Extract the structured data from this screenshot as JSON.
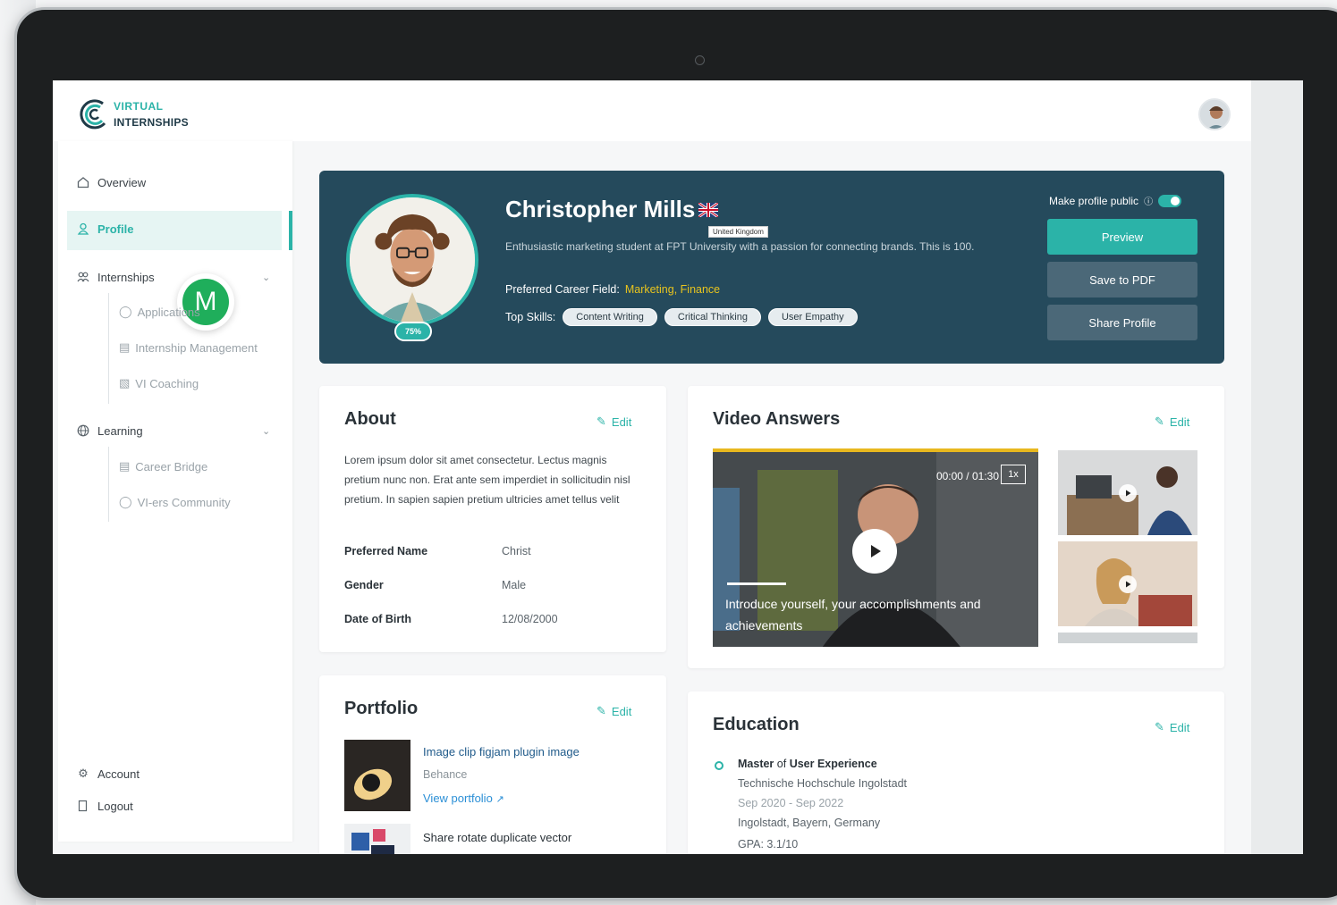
{
  "logo": {
    "line1": "VIRTUAL",
    "line2": "INTERNSHIPS"
  },
  "sidebar": {
    "overview": "Overview",
    "profile": "Profile",
    "internships": "Internships",
    "internships_sub": [
      "Applications",
      "Internship Management",
      "VI Coaching"
    ],
    "learning": "Learning",
    "learning_sub": [
      "Career Bridge",
      "VI-ers Community"
    ],
    "account": "Account",
    "logout": "Logout"
  },
  "bubble_letter": "M",
  "hero": {
    "name": "Christopher Mills",
    "flag_tooltip": "United Kingdom",
    "bio": "Enthusiastic marketing student at FPT University with a passion for connecting brands. This is 100.",
    "career_label": "Preferred Career Field:",
    "career_value": "Marketing, Finance",
    "skills_label": "Top Skills:",
    "skills": [
      "Content Writing",
      "Critical Thinking",
      "User Empathy"
    ],
    "completion": "75%",
    "make_public": "Make profile public",
    "profile_public": true,
    "preview": "Preview",
    "save_pdf": "Save to PDF",
    "share": "Share Profile"
  },
  "about": {
    "title": "About",
    "edit": "Edit",
    "text": "Lorem ipsum dolor sit amet consectetur. Lectus magnis pretium nunc non. Erat ante sem imperdiet in sollicitudin nisl pretium. In sapien sapien pretium ultricies amet tellus velit",
    "fields": [
      {
        "label": "Preferred Name",
        "value": "Christ"
      },
      {
        "label": "Gender",
        "value": "Male"
      },
      {
        "label": "Date of Birth",
        "value": "12/08/2000"
      }
    ]
  },
  "video": {
    "title": "Video Answers",
    "edit": "Edit",
    "time": "00:00 / 01:30",
    "speed": "1x",
    "caption": "Introduce yourself, your accomplishments and achievements"
  },
  "portfolio": {
    "title": "Portfolio",
    "edit": "Edit",
    "items": [
      {
        "title": "Image clip figjam plugin image",
        "source": "Behance",
        "view": "View portfolio"
      },
      {
        "title": "Share rotate duplicate vector"
      }
    ]
  },
  "education": {
    "title": "Education",
    "edit": "Edit",
    "degree_prefix": "Master",
    "degree_of": "of",
    "degree_rest": "User Experience",
    "school": "Technische Hochschule Ingolstadt",
    "dates": "Sep 2020 - Sep 2022",
    "location": "Ingolstadt, Bayern, Germany",
    "gpa": "GPA: 3.1/10"
  },
  "colors": {
    "accent": "#2bb3a8",
    "hero_bg": "#254a5c",
    "highlight": "#e8c41e",
    "secondary_btn": "#4b6878"
  }
}
